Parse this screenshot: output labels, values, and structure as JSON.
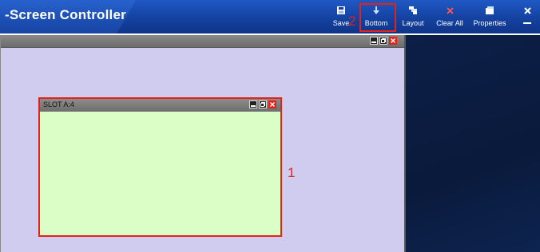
{
  "header": {
    "title": "-Screen Controller"
  },
  "toolbar": {
    "buttons": [
      {
        "label": "Save",
        "icon": "floppy-disk-icon"
      },
      {
        "label": "Bottom",
        "icon": "arrow-down-icon"
      },
      {
        "label": "Layout",
        "icon": "layout-icon"
      },
      {
        "label": "Clear All",
        "icon": "x-icon"
      },
      {
        "label": "Properties",
        "icon": "properties-icon"
      }
    ],
    "close_icon": "close-icon"
  },
  "main": {
    "window_controls": [
      "minimize-icon",
      "restore-icon",
      "close-icon"
    ],
    "slot": {
      "title": "SLOT A:4",
      "fill_color": "#dbfdc6",
      "controls": [
        "minimize-icon",
        "restore-icon",
        "close-icon"
      ]
    }
  },
  "annotations": {
    "slot_marker": "1",
    "bottom_marker": "2",
    "color": "#e2231a"
  },
  "colors": {
    "header_blue": "#1442a0",
    "canvas_lavender": "#d0ccf0",
    "right_panel_navy": "#0a1a3c"
  }
}
